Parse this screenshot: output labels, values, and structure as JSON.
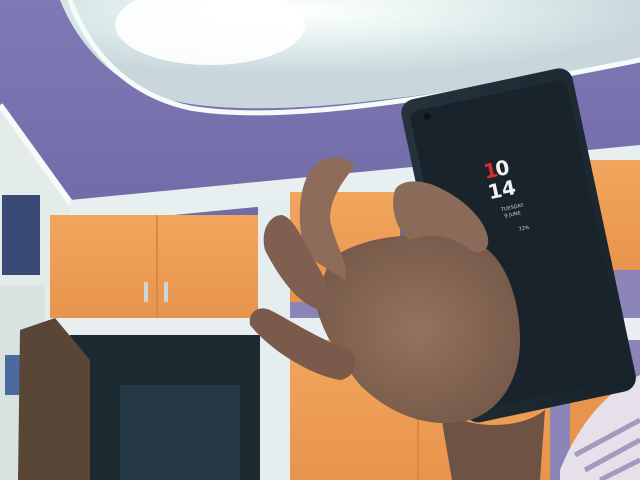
{
  "scene": {
    "description_free": true,
    "colors": {
      "ceiling_purple": "#7d78b4",
      "ceiling_light": "#eef7f6",
      "cabinet_orange": "#f0a055",
      "cabinet_frame": "#e8eef0",
      "doorway_dark": "#1a2a30",
      "skin": "#8a6a58",
      "phone_body": "#1d2a33",
      "accent_red": "#e02a2a"
    }
  },
  "phone_screen": {
    "hour_first_digit": "1",
    "hour_second_digit": "0",
    "minutes": "14",
    "day": "TUESDAY",
    "date": "9 JUNE",
    "battery": "72%"
  }
}
